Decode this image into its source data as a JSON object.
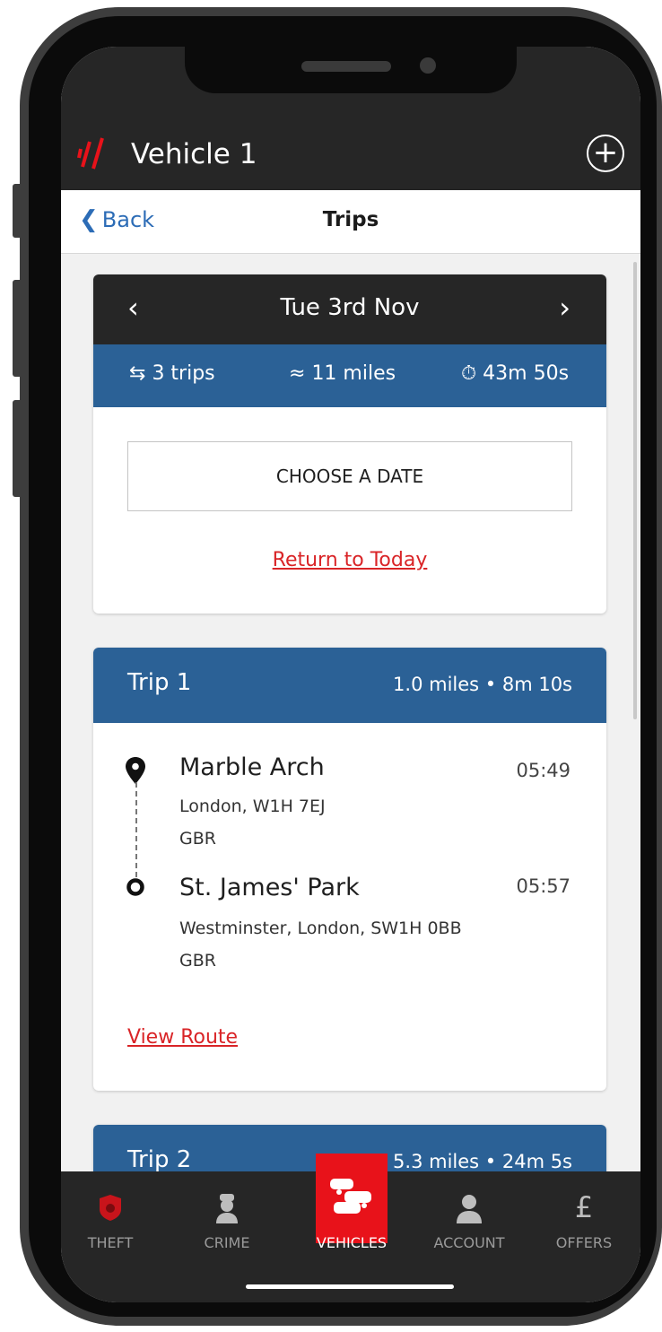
{
  "app": {
    "title": "Vehicle 1",
    "add_icon": "plus-circle-icon"
  },
  "nav": {
    "back_label": "Back",
    "title": "Trips"
  },
  "date_card": {
    "prev_icon": "chevron-left-icon",
    "next_icon": "chevron-right-icon",
    "date": "Tue 3rd Nov",
    "stats": {
      "trips": "3 trips",
      "miles": "11 miles",
      "duration": "43m 50s"
    },
    "choose_label": "CHOOSE A DATE",
    "return_label": "Return to Today"
  },
  "trips": [
    {
      "name": "Trip 1",
      "meta": "1.0 miles • 8m 10s",
      "start": {
        "name": "Marble Arch",
        "line1": "London, W1H 7EJ",
        "line2": "GBR",
        "time": "05:49"
      },
      "end": {
        "name": "St. James' Park",
        "line1": "Westminster, London, SW1H 0BB",
        "line2": "GBR",
        "time": "05:57"
      },
      "view_route_label": "View Route"
    },
    {
      "name": "Trip 2",
      "meta": "5.3 miles • 24m 5s"
    }
  ],
  "tabs": [
    {
      "label": "THEFT",
      "icon": "police-badge-icon",
      "active": false
    },
    {
      "label": "CRIME",
      "icon": "police-officer-icon",
      "active": false
    },
    {
      "label": "VEHICLES",
      "icon": "cars-icon",
      "active": true
    },
    {
      "label": "ACCOUNT",
      "icon": "user-icon",
      "active": false
    },
    {
      "label": "OFFERS",
      "icon": "pound-sign-icon",
      "active": false
    }
  ],
  "colors": {
    "accent_red": "#e8121a",
    "header_dark": "#262626",
    "stats_blue": "#2b6196",
    "link_blue": "#2c6cb6"
  }
}
